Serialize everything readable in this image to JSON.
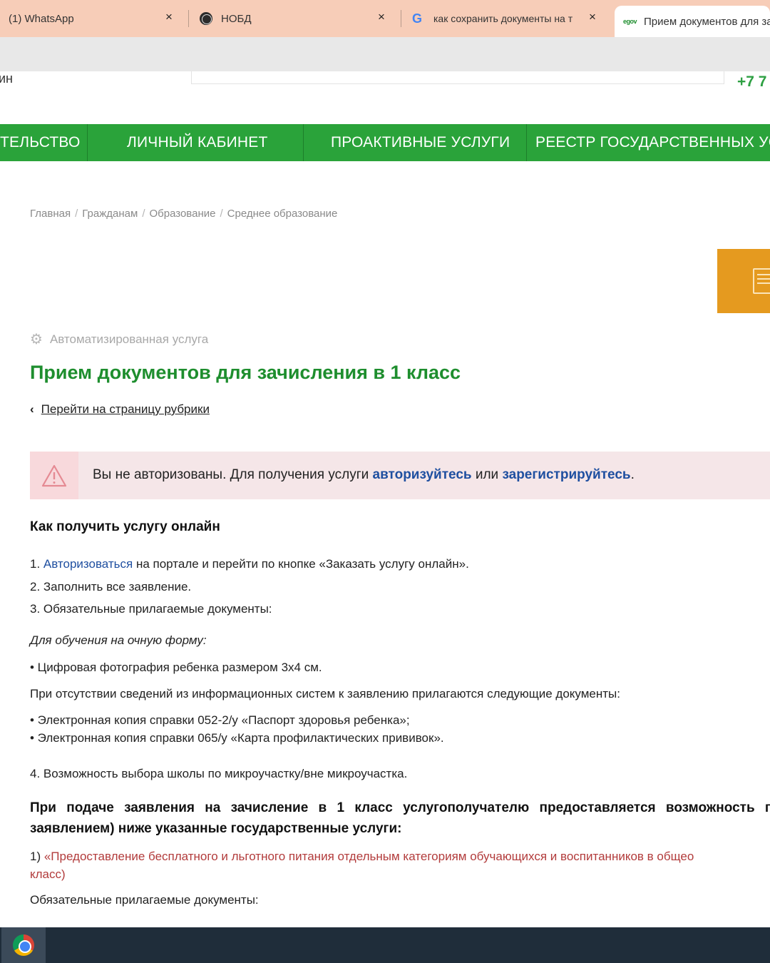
{
  "browser": {
    "tabs": [
      {
        "title": "(1) WhatsApp",
        "close": "×",
        "icon": "whatsapp-icon"
      },
      {
        "title": "НОБД",
        "close": "×",
        "icon": "globe-icon"
      },
      {
        "title": "как сохранить документы на т",
        "close": "×",
        "icon": "google-icon",
        "icon_text": "G"
      },
      {
        "title": "Прием документов для за",
        "icon": "egov-icon",
        "icon_text": "egov",
        "active": true
      }
    ]
  },
  "header": {
    "left_cut_text": "ин",
    "phone": "+7 7"
  },
  "nav": {
    "items": [
      "ТЕЛЬСТВО",
      "ЛИЧНЫЙ КАБИНЕТ",
      "ПРОАКТИВНЫЕ УСЛУГИ",
      "РЕЕСТР ГОСУДАРСТВЕННЫХ УСЛУ"
    ]
  },
  "breadcrumb": {
    "items": [
      "Главная",
      "Гражданам",
      "Образование",
      "Среднее образование"
    ],
    "separator": "/"
  },
  "service": {
    "type_label": "Автоматизированная услуга",
    "title": "Прием документов для зачисления в 1 класс",
    "back_link": "Перейти на страницу рубрики"
  },
  "alert": {
    "text_before": "Вы не авторизованы. Для получения услуги ",
    "link_login": "авторизуйтесь",
    "text_middle": " или ",
    "link_register": "зарегистрируйтесь",
    "text_after": "."
  },
  "content": {
    "heading": "Как получить услугу онлайн",
    "step1_prefix": "1. ",
    "step1_link": "Авторизоваться",
    "step1_rest": " на портале и перейти по кнопке «Заказать услугу онлайн».",
    "step2": "2. Заполнить все заявление.",
    "step3": "3. Обязательные прилагаемые документы:",
    "fulltime_label": "Для обучения на очную форму:",
    "photo_item": "• Цифровая фотография ребенка размером 3х4 см.",
    "absence_note": "При отсутствии сведений из информационных систем к заявлению прилагаются следующие документы:",
    "doc_item_1": "• Электронная копия справки 052-2/у «Паспорт здоровья ребенка»;",
    "doc_item_2": "• Электронная копия справки 065/у «Карта профилактических прививок».",
    "step4": "4. Возможность выбора школы по микроучастку/вне микроучастка.",
    "bold_line_1": "При подаче заявления на зачисление в 1 класс услугополучателю предоставляется возможность п",
    "bold_line_2": "заявлением) ниже указанные государственные услуги:",
    "service1_num": "1) ",
    "service1_link": "«Предоставление бесплатного и льготного питания отдельным категориям обучающихся и воспитанников в общео",
    "service1_line2": "класс)",
    "required_docs": "Обязательные прилагаемые документы:"
  },
  "colors": {
    "nav_green": "#2aa33a",
    "title_green": "#1e8e2e",
    "link_blue": "#1f4fa0",
    "alert_bg": "#f5e6e8",
    "side_button": "#e59a1f",
    "service_link_red": "#b23b3b"
  }
}
